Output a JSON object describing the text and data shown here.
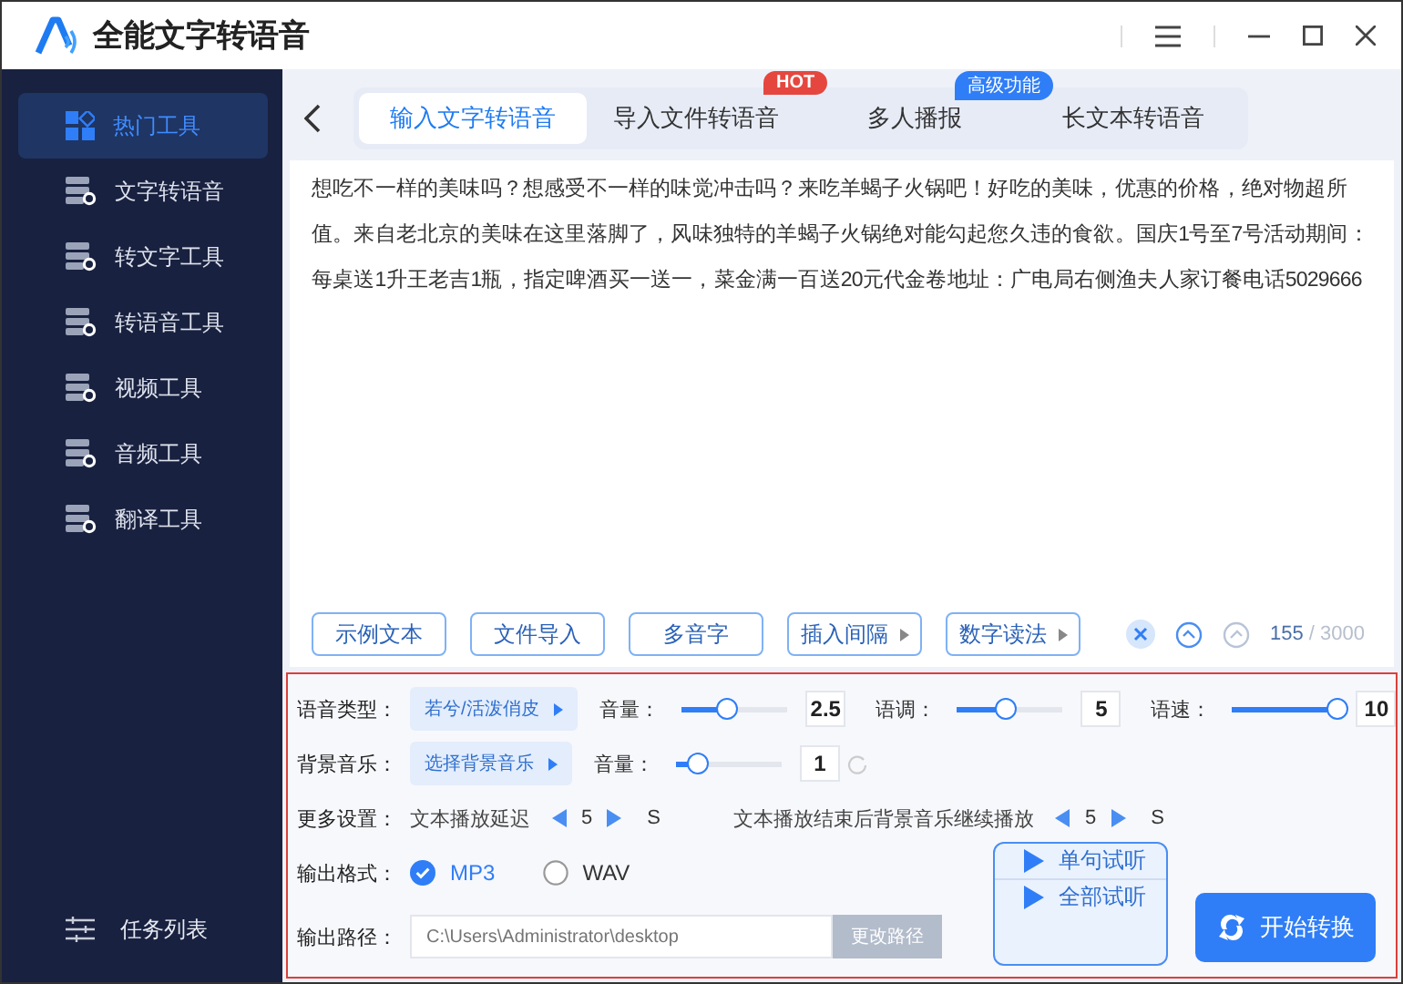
{
  "app": {
    "title": "全能文字转语音"
  },
  "sidebar": {
    "items": [
      {
        "label": "热门工具",
        "selected": true
      },
      {
        "label": "文字转语音",
        "selected": false
      },
      {
        "label": "转文字工具",
        "selected": false
      },
      {
        "label": "转语音工具",
        "selected": false
      },
      {
        "label": "视频工具",
        "selected": false
      },
      {
        "label": "音频工具",
        "selected": false
      },
      {
        "label": "翻译工具",
        "selected": false
      }
    ],
    "footer": {
      "label": "任务列表"
    }
  },
  "tabs": [
    {
      "label": "输入文字转语音",
      "selected": true
    },
    {
      "label": "导入文件转语音",
      "selected": false,
      "badge": {
        "text": "HOT",
        "kind": "hot"
      }
    },
    {
      "label": "多人播报",
      "selected": false,
      "badge": {
        "text": "高级功能",
        "kind": "pro"
      }
    },
    {
      "label": "长文本转语音",
      "selected": false
    }
  ],
  "editor": {
    "text": "想吃不一样的美味吗？想感受不一样的味觉冲击吗？来吃羊蝎子火锅吧！好吃的美味，优惠的价格，绝对物超所值。来自老北京的美味在这里落脚了，风味独特的羊蝎子火锅绝对能勾起您久违的食欲。国庆1号至7号活动期间：每桌送1升王老吉1瓶，指定啤酒买一送一，菜金满一百送20元代金卷地址：广电局右侧渔夫人家订餐电话5029666"
  },
  "tools": [
    {
      "label": "示例文本",
      "has_menu": false
    },
    {
      "label": "文件导入",
      "has_menu": false
    },
    {
      "label": "多音字",
      "has_menu": false
    },
    {
      "label": "插入间隔",
      "has_menu": true
    },
    {
      "label": "数字读法",
      "has_menu": true
    }
  ],
  "counter": {
    "count": "155",
    "limit": "/ 3000"
  },
  "settings": {
    "voice": {
      "label": "语音类型：",
      "value": "若兮/活泼俏皮",
      "sliders": [
        {
          "label": "音量：",
          "level": 0.44,
          "value": "2.5"
        },
        {
          "label": "语调：",
          "level": 0.45,
          "value": "5"
        },
        {
          "label": "语速：",
          "level": 1,
          "value": "10"
        }
      ]
    },
    "music": {
      "label": "背景音乐：",
      "value": "选择背景音乐",
      "sliders": [
        {
          "label": "音量：",
          "level": 0.2,
          "value": "1"
        }
      ]
    },
    "more": {
      "label": "更多设置：",
      "delays": [
        {
          "label": "文本播放延迟",
          "value": "5",
          "unit": "S"
        },
        {
          "label": "文本播放结束后背景音乐继续播放",
          "value": "5",
          "unit": "S"
        }
      ]
    },
    "format": {
      "label": "输出格式：",
      "options": [
        {
          "label": "MP3",
          "selected": true
        },
        {
          "label": "WAV",
          "selected": false
        }
      ]
    },
    "path": {
      "label": "输出路径：",
      "placeholder": "C:\\Users\\Administrator\\desktop",
      "button": "更改路径"
    }
  },
  "preview": [
    "单句试听",
    "全部试听"
  ],
  "start": "开始转换"
}
